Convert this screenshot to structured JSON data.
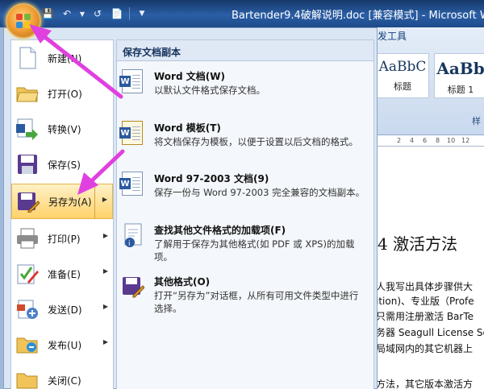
{
  "window": {
    "title": "Bartender9.4破解说明.doc [兼容模式] - Microsoft Word"
  },
  "ribbon": {
    "tab_label": "发工具",
    "styles": [
      {
        "sample": "AaBbC",
        "name": "标题"
      },
      {
        "sample": "AaBb",
        "name": "标题 1"
      }
    ],
    "group_label": "样"
  },
  "document": {
    "heading": "4  激活方法",
    "lines": [
      "人我写出具体步骤供大",
      "ition)、专业版（Profe",
      "只需用注册激活  BarTe",
      "务器  Seagull License Se",
      "局域网内的其它机器上",
      "方法，其它版本激活方"
    ]
  },
  "menu": {
    "left_items": [
      {
        "label": "新建(N)",
        "icon": "new-document-icon",
        "has_submenu": false
      },
      {
        "label": "打开(O)",
        "icon": "open-folder-icon",
        "has_submenu": false
      },
      {
        "label": "转换(V)",
        "icon": "convert-icon",
        "has_submenu": false
      },
      {
        "label": "保存(S)",
        "icon": "save-icon",
        "has_submenu": false
      },
      {
        "label": "另存为(A)",
        "icon": "save-as-icon",
        "has_submenu": true
      },
      {
        "label": "打印(P)",
        "icon": "printer-icon",
        "has_submenu": true
      },
      {
        "label": "准备(E)",
        "icon": "prepare-icon",
        "has_submenu": true
      },
      {
        "label": "发送(D)",
        "icon": "send-icon",
        "has_submenu": true
      },
      {
        "label": "发布(U)",
        "icon": "publish-icon",
        "has_submenu": true
      },
      {
        "label": "关闭(C)",
        "icon": "close-folder-icon",
        "has_submenu": false
      }
    ],
    "save_as": {
      "header": "保存文档副本",
      "items": [
        {
          "title": "Word 文档(W)",
          "desc": "以默认文件格式保存文档。",
          "icon": "word-document-icon"
        },
        {
          "title": "Word 模板(T)",
          "desc": "将文档保存为模板，以便于设置以后文档的格式。",
          "icon": "word-template-icon"
        },
        {
          "title": "Word 97-2003 文档(9)",
          "desc": "保存一份与 Word 97-2003 完全兼容的文档副本。",
          "icon": "word-97-icon"
        },
        {
          "title": "查找其他文件格式的加载项(F)",
          "desc": "了解用于保存为其他格式(如 PDF 或 XPS)的加载项。",
          "icon": "addin-icon"
        },
        {
          "title": "其他格式(O)",
          "desc": "打开“另存为”对话框，从所有可用文件类型中进行选择。",
          "icon": "other-formats-icon"
        }
      ]
    }
  },
  "colors": {
    "active_item": "#ffd26b",
    "annotation_arrow": "#e040e0",
    "titlebar": "#2a5ea5"
  }
}
